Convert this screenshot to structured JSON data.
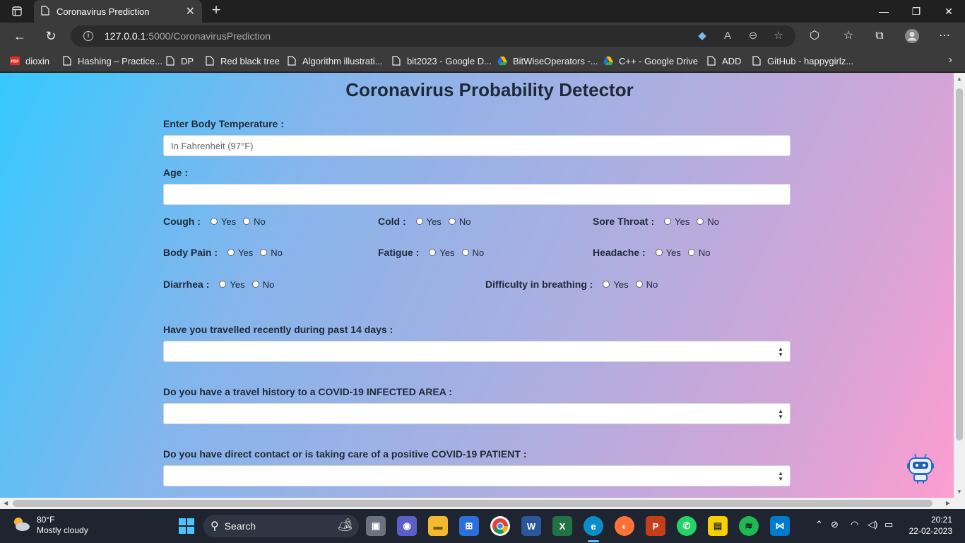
{
  "browser": {
    "tab_title": "Coronavirus Prediction",
    "url_host": "127.0.0.1",
    "url_path": ":5000/CoronavirusPrediction",
    "bookmarks": [
      {
        "label": "dioxin",
        "icon": "pdf-icon"
      },
      {
        "label": "Hashing – Practice...",
        "icon": "page-icon"
      },
      {
        "label": "DP",
        "icon": "page-icon"
      },
      {
        "label": "Red black tree",
        "icon": "page-icon"
      },
      {
        "label": "Algorithm illustrati...",
        "icon": "page-icon"
      },
      {
        "label": "bit2023 - Google D...",
        "icon": "page-icon"
      },
      {
        "label": "BitWiseOperators -...",
        "icon": "google-drive-icon"
      },
      {
        "label": "C++ - Google Drive",
        "icon": "google-drive-icon"
      },
      {
        "label": "ADD",
        "icon": "page-icon"
      },
      {
        "label": "GitHub - happygirlz...",
        "icon": "page-icon"
      }
    ]
  },
  "page": {
    "title": "Coronavirus Probability Detector",
    "temperature_label": "Enter Body Temperature :",
    "temperature_placeholder": "In Fahrenheit (97°F)",
    "age_label": "Age :",
    "yes": "Yes",
    "no": "No",
    "symptoms": {
      "cough": "Cough :",
      "cold": "Cold :",
      "sore_throat": "Sore Throat :",
      "body_pain": "Body Pain :",
      "fatigue": "Fatigue :",
      "headache": "Headache :",
      "diarrhea": "Diarrhea :",
      "breathing": "Difficulty in breathing :"
    },
    "q_travel": "Have you travelled recently during past 14 days :",
    "q_infected_area": "Do you have a travel history to a COVID-19 INFECTED AREA :",
    "q_contact": "Do you have direct contact or is taking care of a positive COVID-19 PATIENT :"
  },
  "taskbar": {
    "temperature": "80°F",
    "weather": "Mostly cloudy",
    "search": "Search",
    "time": "20:21",
    "date": "22-02-2023"
  }
}
